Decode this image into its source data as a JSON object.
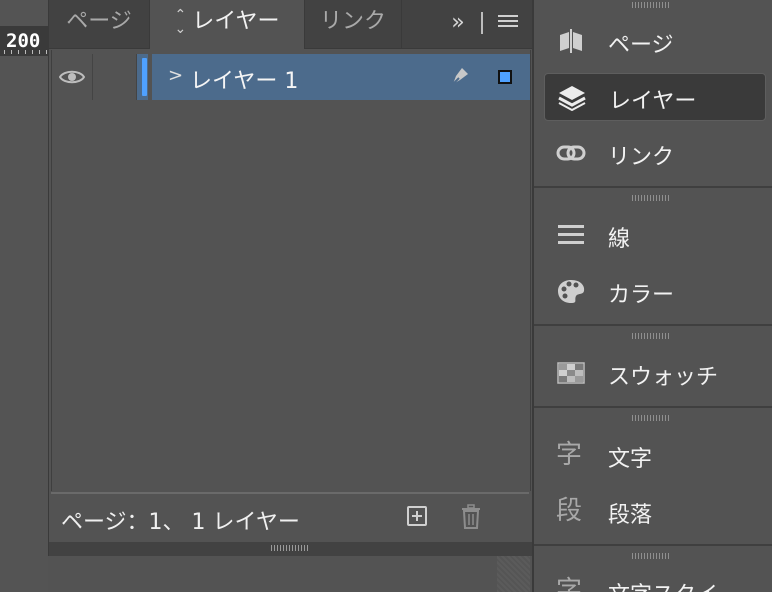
{
  "ruler": {
    "value": "200"
  },
  "panel": {
    "tabs": [
      {
        "label": "ページ",
        "active": false
      },
      {
        "label": "レイヤー",
        "active": true
      },
      {
        "label": "リンク",
        "active": false
      }
    ],
    "overflow_label": "»",
    "layers": [
      {
        "name": "レイヤー 1",
        "color": "#4fa1ff",
        "selected": true
      }
    ],
    "footer": {
      "status": "ページ：1、 1 レイヤー"
    }
  },
  "dock": {
    "groups": [
      {
        "items": [
          {
            "label": "ページ",
            "icon": "pages-icon",
            "active": false
          },
          {
            "label": "レイヤー",
            "icon": "layers-icon",
            "active": true
          },
          {
            "label": "リンク",
            "icon": "link-icon",
            "active": false
          }
        ]
      },
      {
        "items": [
          {
            "label": "線",
            "icon": "stroke-icon",
            "active": false
          },
          {
            "label": "カラー",
            "icon": "palette-icon",
            "active": false
          }
        ]
      },
      {
        "items": [
          {
            "label": "スウォッチ",
            "icon": "swatches-icon",
            "active": false
          }
        ]
      },
      {
        "items": [
          {
            "label": "文字",
            "icon": "character-icon",
            "icon_glyph": "字",
            "active": false
          },
          {
            "label": "段落",
            "icon": "paragraph-icon",
            "icon_glyph": "段",
            "active": false
          }
        ]
      },
      {
        "items": [
          {
            "label": "文字スタイ",
            "icon": "character-styles-icon",
            "icon_glyph": "字",
            "active": false
          }
        ]
      }
    ]
  },
  "colors": {
    "selection": "#4c6b8c",
    "layer_color": "#4fa1ff",
    "panel_bg": "#535353"
  }
}
